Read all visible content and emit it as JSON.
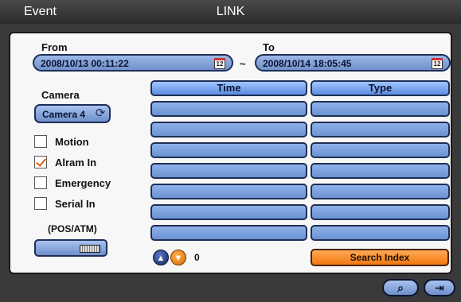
{
  "title": {
    "left": "Event",
    "center": "LINK"
  },
  "from": {
    "label": "From",
    "value": "2008/10/13   00:11:22",
    "calendar_text": "12"
  },
  "to": {
    "label": "To",
    "value": "2008/10/14   18:05:45",
    "calendar_text": "12"
  },
  "range_separator": "~",
  "camera": {
    "label": "Camera",
    "selected": "Camera 4",
    "refresh_icon": "refresh-icon"
  },
  "filters": [
    {
      "label": "Motion",
      "checked": false
    },
    {
      "label": "Alram In",
      "checked": true
    },
    {
      "label": "Emergency",
      "checked": false
    },
    {
      "label": "Serial In",
      "checked": false
    }
  ],
  "pos_atm": {
    "label": "(POS/ATM)",
    "keyboard_icon": "keyboard-icon"
  },
  "table": {
    "headers": [
      "Time",
      "Type"
    ],
    "rows": 7
  },
  "pager": {
    "up_icon": "chevron-up-icon",
    "down_icon": "chevron-down-icon",
    "count": "0"
  },
  "search_button": "Search Index",
  "footer": {
    "search_icon": "search-icon",
    "exit_icon": "exit-icon"
  },
  "colors": {
    "accent": "#6e8fca",
    "search": "#f2770f",
    "check": "#e06010"
  }
}
